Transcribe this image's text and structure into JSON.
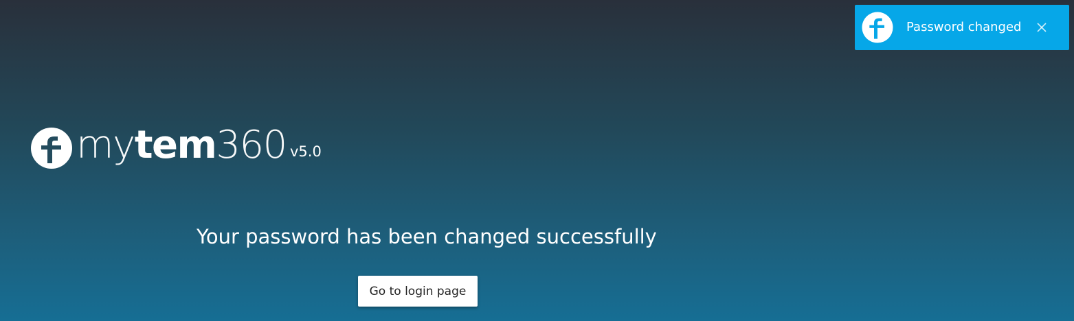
{
  "toast": {
    "icon": "mytem-logo-icon",
    "message": "Password changed",
    "close_icon": "close-icon",
    "background": "#06a7e8"
  },
  "brand": {
    "name_prefix": "my",
    "name_bold": "tem",
    "name_suffix": "360",
    "version": "v5.0",
    "icon": "mytem-logo-icon"
  },
  "main": {
    "message": "Your password has been changed successfully",
    "button_label": "Go to login page"
  }
}
